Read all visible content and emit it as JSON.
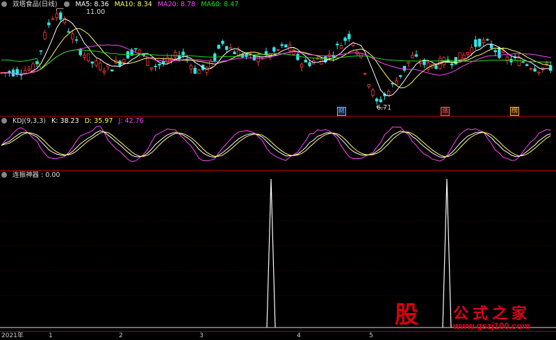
{
  "price_panel": {
    "name": "双塔食品(日线)",
    "indicators": [
      {
        "label": "MA5: 8.36",
        "color": "#ffffff"
      },
      {
        "label": "MA10: 8.34",
        "color": "#ffff66"
      },
      {
        "label": "MA20: 8.78",
        "color": "#ff44ff"
      },
      {
        "label": "MA60: 8.47",
        "color": "#22dd22"
      }
    ],
    "high_label": "11.00",
    "low_label": "6.71",
    "markers": [
      {
        "text": "财",
        "color": "#66bbff"
      },
      {
        "text": "涨",
        "color": "#ff5555"
      },
      {
        "text": "榜",
        "color": "#ffaa33"
      }
    ]
  },
  "kdj_panel": {
    "title": "KDJ(9,3,3)",
    "indicators": [
      {
        "label": "K: 38.23",
        "color": "#ffffff"
      },
      {
        "label": "D: 35.97",
        "color": "#ffff66"
      },
      {
        "label": "J: 42.76",
        "color": "#ff44ff"
      }
    ]
  },
  "signal_panel": {
    "title": "连振神器",
    "value": ": 0.00"
  },
  "x_axis": {
    "ticks": [
      "2021年",
      "1",
      "2",
      "3",
      "4",
      "5"
    ]
  },
  "watermark": {
    "logo": "股",
    "title": "公式之家",
    "url": "www.gszj100.com"
  },
  "chart_data": {
    "type": "candlestick",
    "x_ticks": [
      "2021年",
      "1",
      "2",
      "3",
      "4",
      "5"
    ],
    "y_range": [
      6.5,
      11.2
    ],
    "annotations": [
      {
        "label": "11.00",
        "value": 11.0
      },
      {
        "label": "6.71",
        "value": 6.71
      }
    ],
    "ma_values": {
      "MA5": 8.36,
      "MA10": 8.34,
      "MA20": 8.78,
      "MA60": 8.47
    },
    "kdj_values": {
      "K": 38.23,
      "D": 35.97,
      "J": 42.76
    },
    "signal_value": 0.0,
    "signal_peaks_at_month": [
      "3-4",
      "5"
    ]
  }
}
